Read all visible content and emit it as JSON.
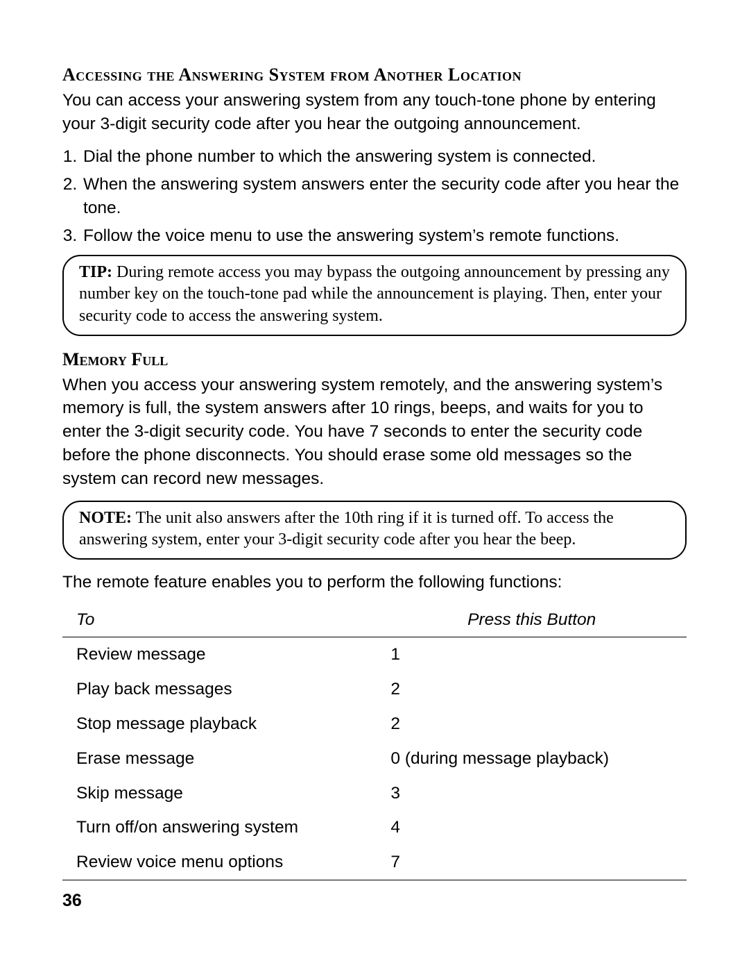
{
  "section1": {
    "heading": "Accessing the Answering System from Another Location",
    "intro": "You can access your answering system from any touch-tone phone by entering your 3-digit security code after you hear the outgoing announcement.",
    "steps": [
      "Dial the phone number to which the answering system is connected.",
      "When the answering system answers enter the security code after you hear the tone.",
      "Follow the voice menu to use the answering system’s remote functions."
    ],
    "tip_label": "TIP:",
    "tip_body": " During remote access you may bypass the outgoing announcement by pressing any number key on the touch-tone pad while the announcement is playing. Then, enter your security code to access the answering system."
  },
  "section2": {
    "heading": "Memory Full",
    "body": "When you access your answering system remotely, and the answering system’s memory is full, the system answers after 10 rings, beeps, and waits for you to enter the 3-digit security code. You have 7 seconds to enter the security code before the phone disconnects. You should erase some old messages so the system can record new messages.",
    "note_label": "NOTE:",
    "note_body": " The unit also answers after the 10th ring if it is turned off. To access the answering system, enter your 3-digit security code after you hear the beep."
  },
  "table_intro": "The remote feature enables you to perform the following functions:",
  "table": {
    "headers": [
      "To",
      "Press this Button"
    ],
    "rows": [
      [
        "Review message",
        "1"
      ],
      [
        "Play back messages",
        "2"
      ],
      [
        "Stop message playback",
        "2"
      ],
      [
        "Erase message",
        "0 (during message playback)"
      ],
      [
        "Skip message",
        "3"
      ],
      [
        "Turn off/on answering system",
        "4"
      ],
      [
        "Review voice menu options",
        "7"
      ]
    ]
  },
  "page_number": "36"
}
